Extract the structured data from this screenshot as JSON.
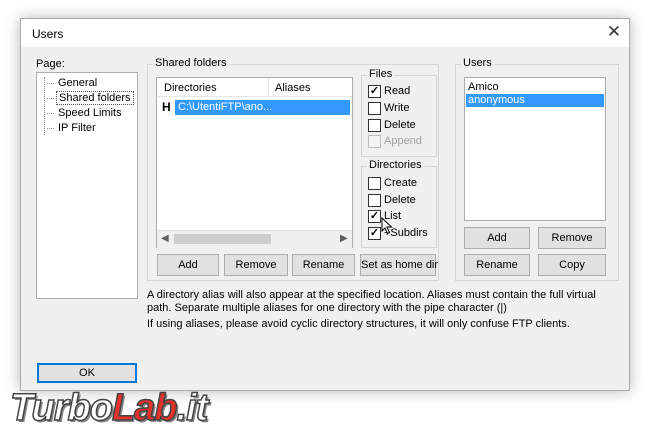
{
  "window": {
    "title": "Users",
    "close_glyph": "✕"
  },
  "page_panel": {
    "label": "Page:",
    "items": [
      {
        "label": "General",
        "selected": false
      },
      {
        "label": "Shared folders",
        "selected": true
      },
      {
        "label": "Speed Limits",
        "selected": false
      },
      {
        "label": "IP Filter",
        "selected": false
      }
    ]
  },
  "shared_folders": {
    "title": "Shared folders",
    "columns": [
      "Directories",
      "Aliases"
    ],
    "rows": [
      {
        "marker": "H",
        "directory": "C:\\UtentiFTP\\ano...",
        "alias": ""
      }
    ],
    "buttons": {
      "add": "Add",
      "remove": "Remove",
      "rename": "Rename",
      "set_home": "Set as home dir"
    }
  },
  "files": {
    "title": "Files",
    "options": [
      {
        "label": "Read",
        "checked": true,
        "disabled": false
      },
      {
        "label": "Write",
        "checked": false,
        "disabled": false
      },
      {
        "label": "Delete",
        "checked": false,
        "disabled": false
      },
      {
        "label": "Append",
        "checked": false,
        "disabled": true
      }
    ]
  },
  "directories": {
    "title": "Directories",
    "options": [
      {
        "label": "Create",
        "checked": false
      },
      {
        "label": "Delete",
        "checked": false
      },
      {
        "label": "List",
        "checked": true
      },
      {
        "label": "+Subdirs",
        "checked": true
      }
    ]
  },
  "users": {
    "title": "Users",
    "list": [
      {
        "name": "Amico",
        "selected": false
      },
      {
        "name": "anonymous",
        "selected": true
      }
    ],
    "buttons": {
      "add": "Add",
      "remove": "Remove",
      "rename": "Rename",
      "copy": "Copy"
    }
  },
  "info": {
    "line1": "A directory alias will also appear at the specified location. Aliases must contain the full virtual",
    "line2": "path. Separate multiple aliases for one directory with the pipe character (|)",
    "line3": "If using aliases, please avoid cyclic directory structures, it will only confuse FTP clients."
  },
  "ok_button": "OK",
  "watermark": {
    "part1": "Turbo",
    "part2": "Lab",
    "part3": ".it"
  },
  "colors": {
    "selection": "#3399ff",
    "ok_border": "#0078d7",
    "dialog_bg": "#f0f0f0"
  }
}
